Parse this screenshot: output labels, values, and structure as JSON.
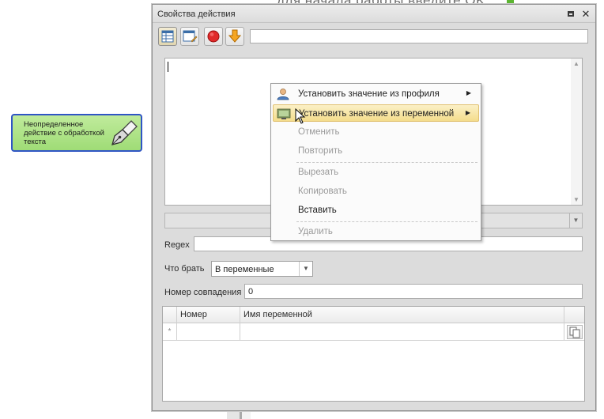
{
  "background": {
    "headline": "для начала работы введите OK",
    "node": {
      "label": "Неопределенное действие с обработкой текста",
      "icon": "pen-nib-icon",
      "color": "#a9e183",
      "border_color": "#2f55c5"
    }
  },
  "dialog": {
    "title": "Свойства действия",
    "titlebar_buttons": [
      "restore-icon",
      "close-icon"
    ],
    "toolbar": {
      "buttons": [
        {
          "name": "properties-grid-icon",
          "active": true
        },
        {
          "name": "edit-window-icon",
          "active": false
        },
        {
          "name": "stop-red-circle-icon",
          "active": false
        },
        {
          "name": "download-orange-arrow-icon",
          "active": false
        }
      ],
      "input_value": ""
    },
    "text_area_value": "",
    "regex": {
      "label": "Regex",
      "value": ""
    },
    "what_to_take": {
      "label": "Что брать",
      "selected": "В переменные"
    },
    "match_number": {
      "label": "Номер совпадения",
      "value": "0"
    },
    "grid": {
      "columns": [
        "Номер",
        "Имя переменной"
      ],
      "new_row_marker": "*",
      "rows": []
    }
  },
  "context_menu": {
    "items": [
      {
        "label": "Установить значение из профиля",
        "icon": "user-profile-icon",
        "submenu": true,
        "disabled": false,
        "highlighted": false
      },
      {
        "label": "Установить значение из переменной",
        "icon": "variable-monitor-icon",
        "submenu": true,
        "disabled": false,
        "highlighted": true
      },
      {
        "label": "Отменить",
        "disabled": true
      },
      {
        "label": "Повторить",
        "disabled": true
      },
      {
        "label": "Вырезать",
        "disabled": true
      },
      {
        "label": "Копировать",
        "disabled": true
      },
      {
        "label": "Вставить",
        "disabled": false
      },
      {
        "label": "Удалить",
        "disabled": true
      }
    ],
    "submenu_arrow": "▶"
  }
}
